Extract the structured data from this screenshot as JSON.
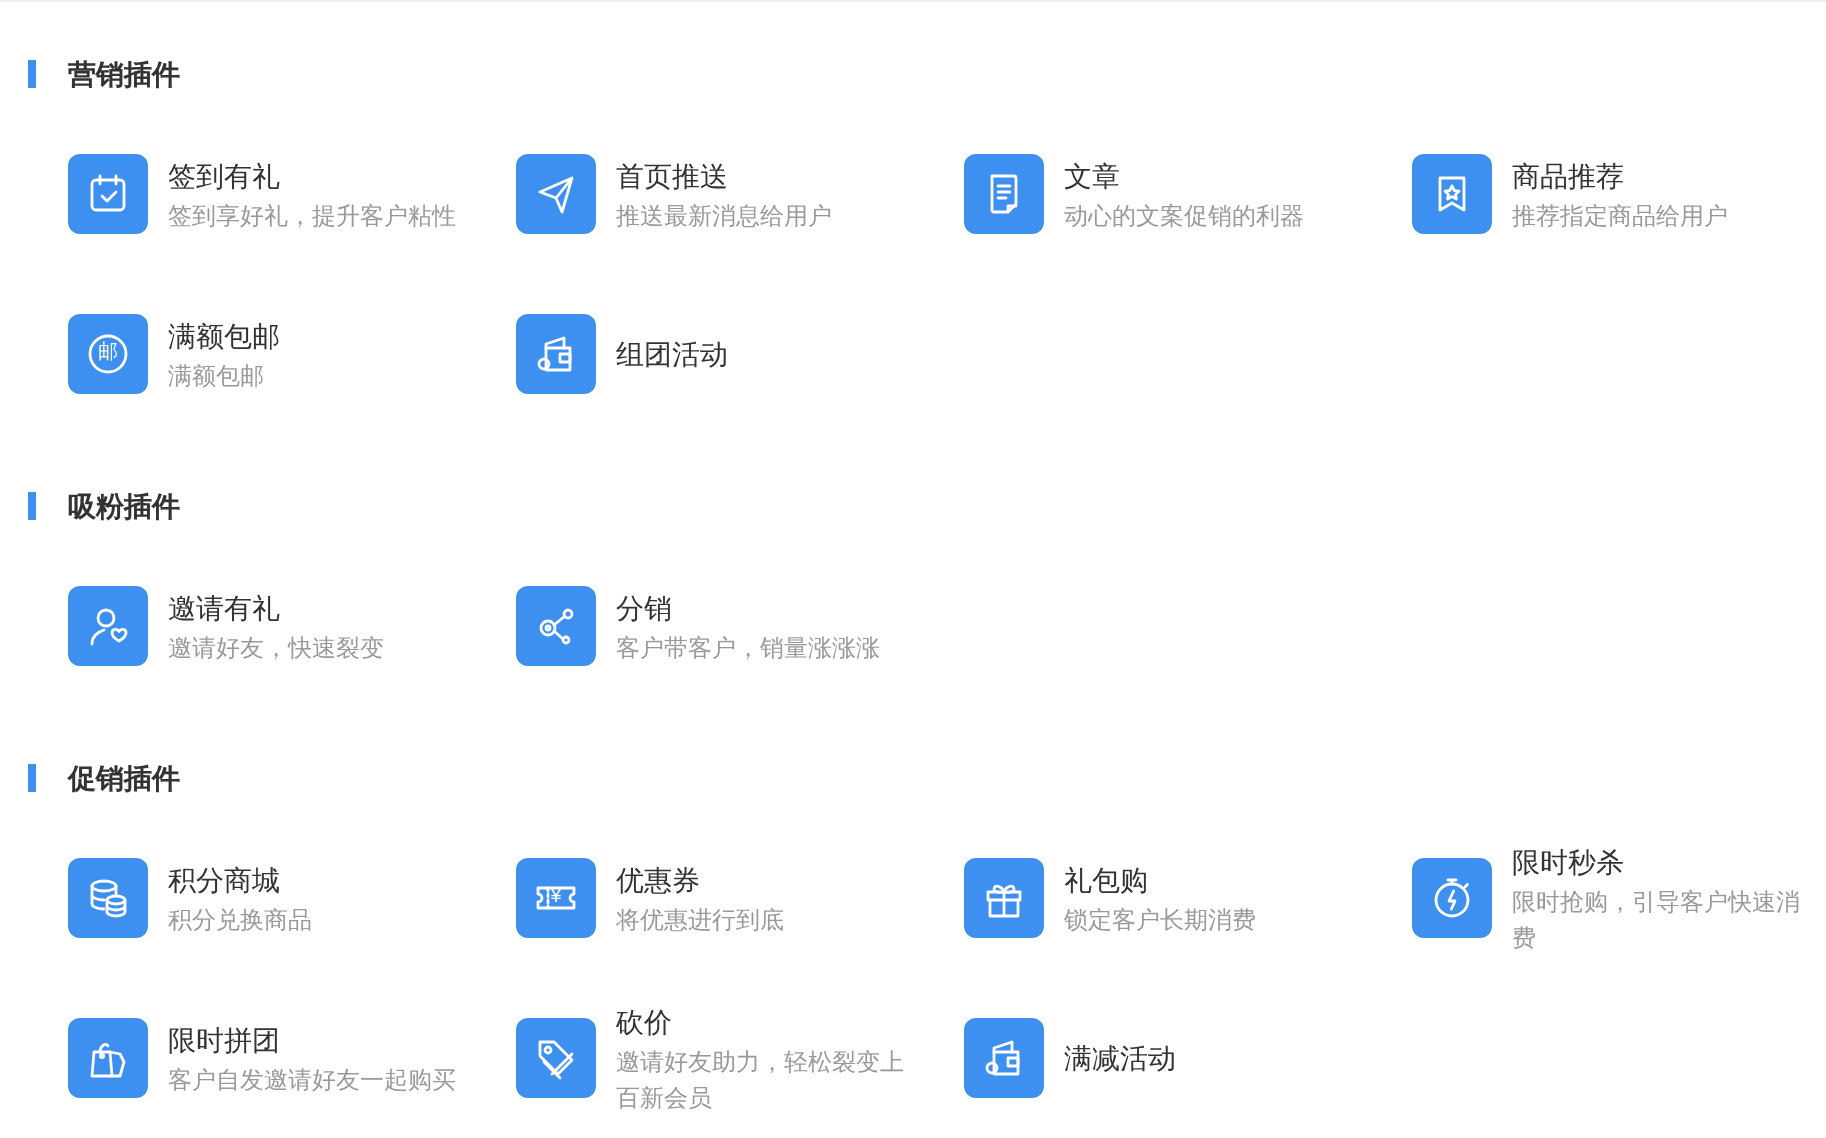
{
  "sections": [
    {
      "title": "营销插件",
      "items": [
        {
          "title": "签到有礼",
          "description": "签到享好礼，提升客户粘性"
        },
        {
          "title": "首页推送",
          "description": "推送最新消息给用户"
        },
        {
          "title": "文章",
          "description": "动心的文案促销的利器"
        },
        {
          "title": "商品推荐",
          "description": "推荐指定商品给用户"
        },
        {
          "title": "满额包邮",
          "description": "满额包邮",
          "icon_glyph": "邮"
        },
        {
          "title": "组团活动"
        }
      ]
    },
    {
      "title": "吸粉插件",
      "items": [
        {
          "title": "邀请有礼",
          "description": "邀请好友，快速裂变"
        },
        {
          "title": "分销",
          "description": "客户带客户，销量涨涨涨"
        }
      ]
    },
    {
      "title": "促销插件",
      "items": [
        {
          "title": "积分商城",
          "description": "积分兑换商品"
        },
        {
          "title": "优惠券",
          "description": "将优惠进行到底",
          "icon_glyph": "¥"
        },
        {
          "title": "礼包购",
          "description": "锁定客户长期消费"
        },
        {
          "title": "限时秒杀",
          "description": "限时抢购，引导客户快速消费"
        },
        {
          "title": "限时拼团",
          "description": "客户自发邀请好友一起购买"
        },
        {
          "title": "砍价",
          "description": "邀请好友助力，轻松裂变上百新会员"
        },
        {
          "title": "满减活动"
        }
      ]
    }
  ]
}
